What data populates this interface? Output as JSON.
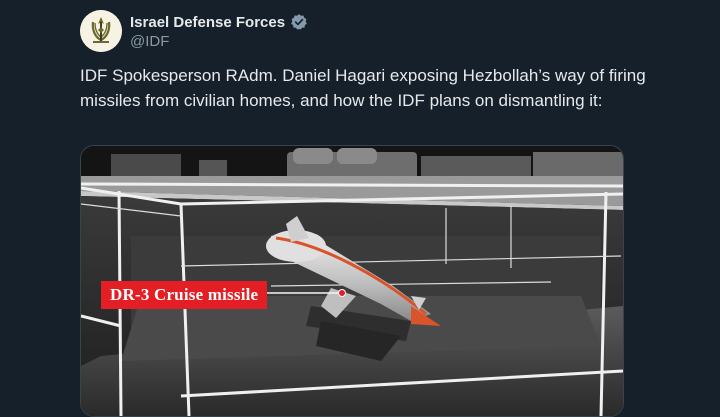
{
  "tweet": {
    "display_name": "Israel Defense Forces",
    "handle": "@IDF",
    "text": "IDF Spokesperson RAdm. Daniel Hagari exposing Hezbollah’s way of firing missiles from civilian homes, and how the IDF plans on dismantling it:",
    "verified": true,
    "avatar_icon": "idf-emblem-icon"
  },
  "media": {
    "label": "DR-3 Cruise missile",
    "label_color": "#e31e24"
  },
  "colors": {
    "background": "#15202b",
    "text": "#e7e9ea",
    "muted": "#8b98a5",
    "verified": "#829aab"
  }
}
